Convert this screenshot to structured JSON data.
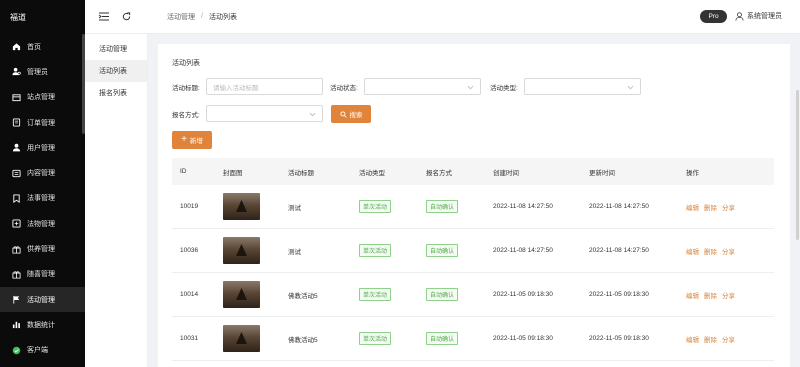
{
  "app": {
    "logo": "福道"
  },
  "sidebar": {
    "items": [
      {
        "label": "首页",
        "icon": "home-icon"
      },
      {
        "label": "管理员",
        "icon": "admin-user-icon"
      },
      {
        "label": "站点管理",
        "icon": "site-icon"
      },
      {
        "label": "订单管理",
        "icon": "order-icon"
      },
      {
        "label": "用户管理",
        "icon": "user-icon"
      },
      {
        "label": "内容管理",
        "icon": "content-icon"
      },
      {
        "label": "法事管理",
        "icon": "ritual-icon"
      },
      {
        "label": "法物管理",
        "icon": "relic-icon"
      },
      {
        "label": "供养管理",
        "icon": "offering-icon"
      },
      {
        "label": "随喜管理",
        "icon": "donation-icon"
      },
      {
        "label": "活动管理",
        "icon": "flag-icon"
      },
      {
        "label": "数据统计",
        "icon": "bar-chart-icon"
      },
      {
        "label": "客户端",
        "icon": "client-icon"
      }
    ],
    "active_index": 10
  },
  "header": {
    "breadcrumb": [
      "活动管理",
      "活动列表"
    ],
    "pro_badge": "Pro",
    "user": "系统管理员"
  },
  "subnav": {
    "items": [
      "活动管理",
      "活动列表",
      "报名列表"
    ],
    "active_index": 1
  },
  "main": {
    "title": "活动列表",
    "filters": {
      "title_label": "活动标题:",
      "title_placeholder": "请输入活动标题",
      "status_label": "活动状态:",
      "type_label": "活动类型:",
      "signup_label": "报名方式:",
      "search_button": "搜索"
    },
    "add_button": "新增",
    "table": {
      "columns": [
        "ID",
        "封面图",
        "活动标题",
        "活动类型",
        "报名方式",
        "创建时间",
        "更新时间",
        "操作"
      ],
      "rows": [
        {
          "id": "10019",
          "title": "测试",
          "type": "单次活动",
          "signup": "自动确认",
          "created": "2022-11-08 14:27:50",
          "updated": "2022-11-08 14:27:50"
        },
        {
          "id": "10036",
          "title": "测试",
          "type": "单次活动",
          "signup": "自动确认",
          "created": "2022-11-08 14:27:50",
          "updated": "2022-11-08 14:27:50"
        },
        {
          "id": "10014",
          "title": "佛教活动5",
          "type": "单次活动",
          "signup": "自动确认",
          "created": "2022-11-05 09:18:30",
          "updated": "2022-11-05 09:18:30"
        },
        {
          "id": "10031",
          "title": "佛教活动5",
          "type": "单次活动",
          "signup": "自动确认",
          "created": "2022-11-05 09:18:30",
          "updated": "2022-11-05 09:18:30"
        }
      ],
      "actions": [
        "编辑",
        "删除",
        "分享"
      ]
    }
  },
  "colors": {
    "accent": "#e0843c",
    "sidebar_bg": "#0b0b0b",
    "tag_green": "#52a84a"
  }
}
